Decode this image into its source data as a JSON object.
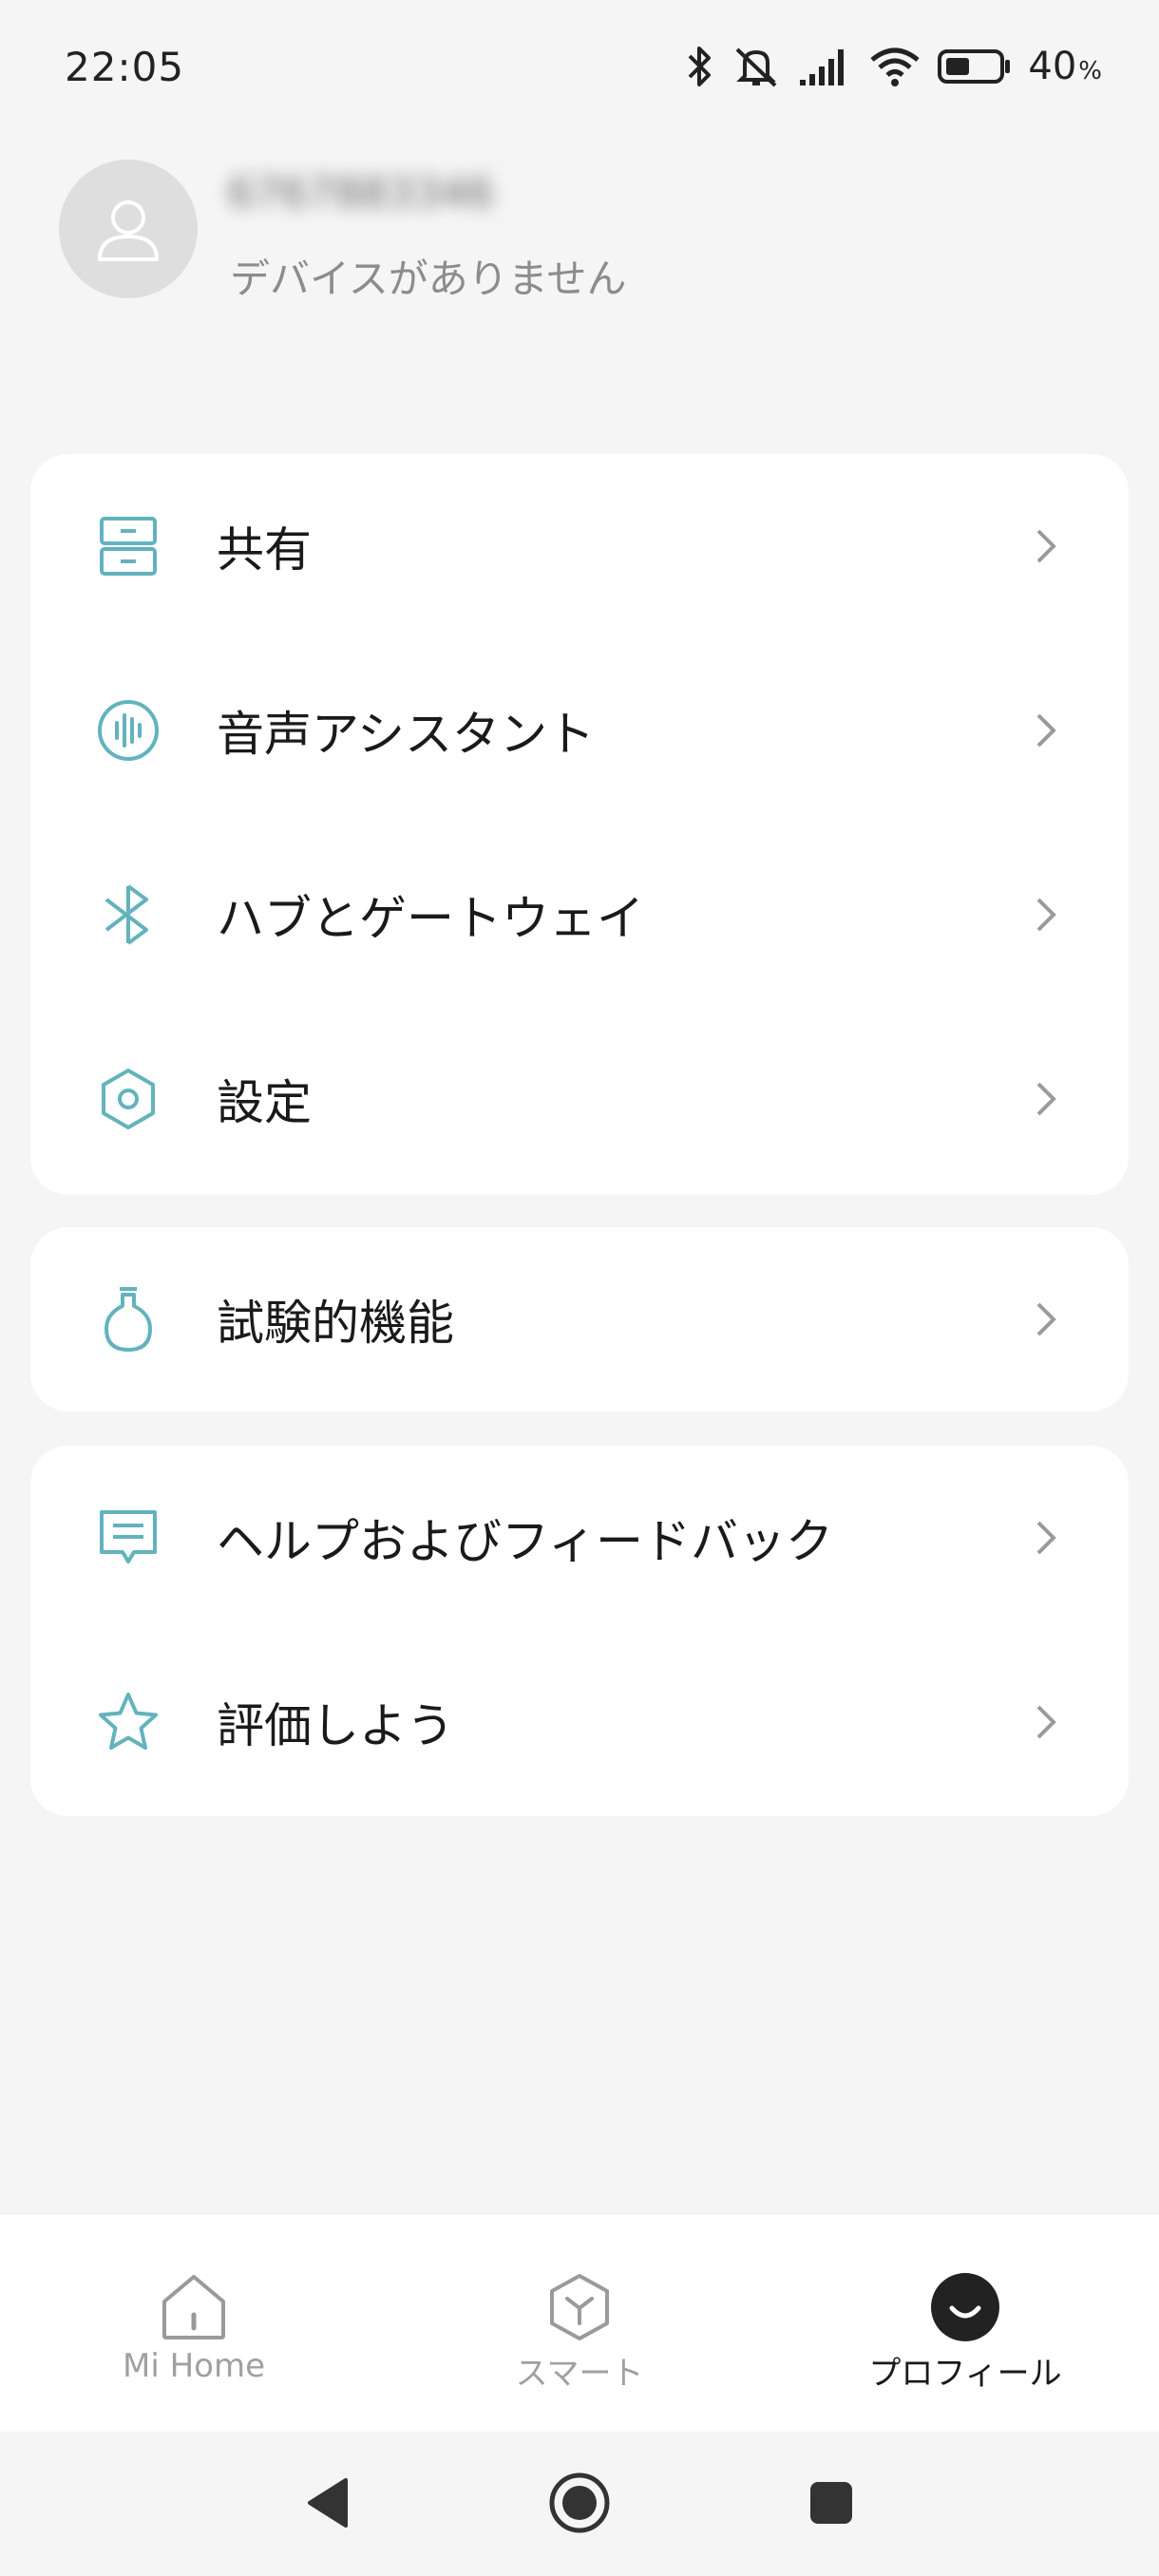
{
  "status_bar": {
    "time": "22:05",
    "battery_level": "40",
    "battery_unit": "%",
    "icons": [
      "bluetooth-icon",
      "mute-icon",
      "signal-icon",
      "wifi-icon",
      "battery-icon"
    ]
  },
  "profile": {
    "user_id": "6767883346",
    "subtitle": "デバイスがありません"
  },
  "menu": {
    "group1": [
      {
        "label": "共有",
        "icon": "share-drawer-icon"
      },
      {
        "label": "音声アシスタント",
        "icon": "voice-assistant-icon"
      },
      {
        "label": "ハブとゲートウェイ",
        "icon": "bluetooth-gateway-icon"
      },
      {
        "label": "設定",
        "icon": "settings-hexagon-icon"
      }
    ],
    "group2": [
      {
        "label": "試験的機能",
        "icon": "experiment-flask-icon"
      }
    ],
    "group3": [
      {
        "label": "ヘルプおよびフィードバック",
        "icon": "feedback-message-icon"
      },
      {
        "label": "評価しよう",
        "icon": "star-icon"
      }
    ]
  },
  "tabs": [
    {
      "label": "Mi Home",
      "icon": "home-icon",
      "active": false
    },
    {
      "label": "スマート",
      "icon": "smart-cube-icon",
      "active": false
    },
    {
      "label": "プロフィール",
      "icon": "profile-smile-icon",
      "active": true
    }
  ],
  "colors": {
    "accent": "#62b3be",
    "background": "#f5f5f5",
    "card": "#ffffff",
    "text_primary": "#1a1a1a",
    "text_secondary": "#8c8c8c"
  }
}
